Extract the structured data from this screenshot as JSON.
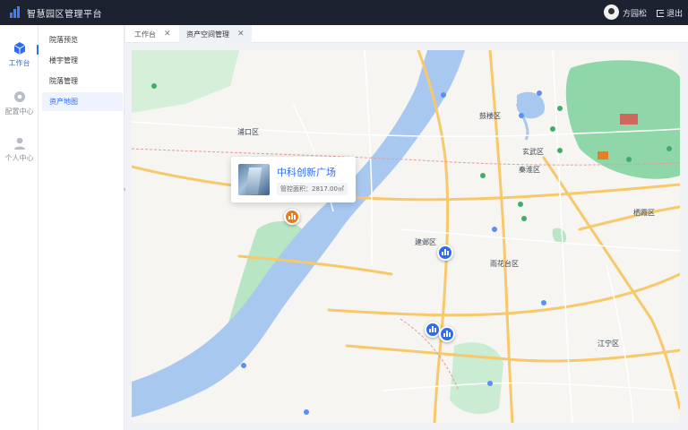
{
  "app": {
    "title": "智慧园区管理平台"
  },
  "header": {
    "user_name": "方园松",
    "logout_label": "退出"
  },
  "rail": {
    "items": [
      {
        "label": "工作台",
        "icon": "cube-icon"
      },
      {
        "label": "配置中心",
        "icon": "gear-icon"
      },
      {
        "label": "个人中心",
        "icon": "user-icon"
      }
    ]
  },
  "submenu": {
    "items": [
      {
        "label": "院落预览"
      },
      {
        "label": "楼宇管理"
      },
      {
        "label": "院落管理"
      },
      {
        "label": "资产地图"
      }
    ]
  },
  "tabs": [
    {
      "label": "工作台"
    },
    {
      "label": "资产空间管理"
    }
  ],
  "map": {
    "popup": {
      "title": "中科创新广场",
      "area_label": "管控面积：2817.00㎡"
    },
    "labels": [
      {
        "text": "浦口区"
      },
      {
        "text": "建邺区"
      },
      {
        "text": "秦淮区"
      },
      {
        "text": "玄武区"
      },
      {
        "text": "雨花台区"
      },
      {
        "text": "江宁区"
      },
      {
        "text": "鼓楼区"
      },
      {
        "text": "栖霞区"
      }
    ]
  },
  "colors": {
    "accent": "#2f6bf0",
    "topbar": "#1c2230",
    "marker_orange": "#f07a1a",
    "river": "#a8c8f0",
    "green": "#8fd6a8"
  }
}
